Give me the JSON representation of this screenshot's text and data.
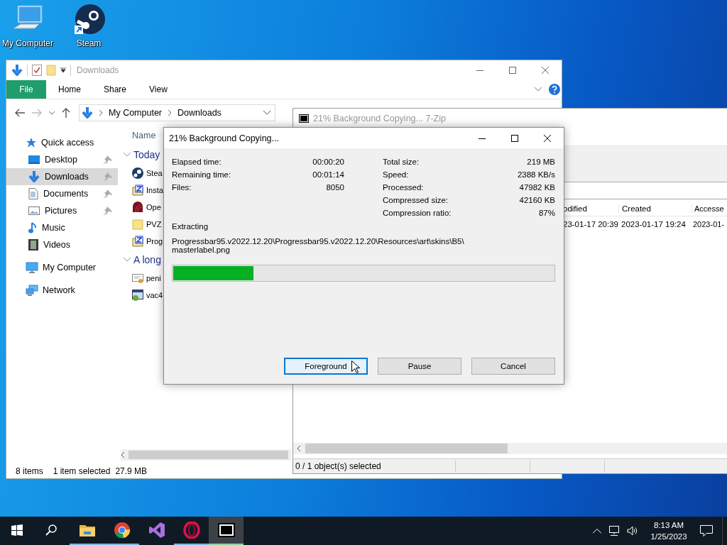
{
  "desktop_icons": [
    {
      "label": "My Computer"
    },
    {
      "label": "Steam"
    }
  ],
  "explorer": {
    "title": "Downloads",
    "ribbon_tabs": [
      {
        "label": "File",
        "kind": "file-menu"
      },
      {
        "label": "Home",
        "kind": "tab"
      },
      {
        "label": "Share",
        "kind": "tab"
      },
      {
        "label": "View",
        "kind": "tab"
      }
    ],
    "address": [
      "My Computer",
      "Downloads"
    ],
    "nav": [
      {
        "label": "Quick access",
        "selected": false,
        "pinned": false,
        "children": [
          {
            "label": "Desktop",
            "selected": false,
            "pinned": true
          },
          {
            "label": "Downloads",
            "selected": true,
            "pinned": true
          },
          {
            "label": "Documents",
            "selected": false,
            "pinned": true
          },
          {
            "label": "Pictures",
            "selected": false,
            "pinned": true
          },
          {
            "label": "Music",
            "selected": false,
            "pinned": false
          },
          {
            "label": "Videos",
            "selected": false,
            "pinned": false
          }
        ]
      },
      {
        "label": "My Computer",
        "selected": false,
        "pinned": false
      },
      {
        "label": "Network",
        "selected": false,
        "pinned": false
      }
    ],
    "name_column": "Name",
    "groups": [
      {
        "label": "Today",
        "items": [
          "Stea",
          "Insta",
          "Ope",
          "PVZ",
          "Prog"
        ]
      },
      {
        "label": "A long",
        "items": [
          "peni",
          "vac4"
        ]
      }
    ],
    "status": {
      "count": "8 items",
      "selection": "1 item selected",
      "size": "27.9 MB"
    }
  },
  "sevenzip": {
    "title": "21% Background Copying... 7-Zip",
    "columns": [
      "odified",
      "Created",
      "Accesse"
    ],
    "rows": [
      [
        "23-01-17 20:39",
        "2023-01-17 19:24",
        "2023-01-"
      ]
    ],
    "status": "0 / 1 object(s) selected"
  },
  "dialog": {
    "title": "21% Background Copying...",
    "left_stats": [
      {
        "label": "Elapsed time:",
        "value": "00:00:20"
      },
      {
        "label": "Remaining time:",
        "value": "00:01:14"
      },
      {
        "label": "Files:",
        "value": "8050"
      }
    ],
    "right_stats": [
      {
        "label": "Total size:",
        "value": "219 MB"
      },
      {
        "label": "Speed:",
        "value": "2388 KB/s"
      },
      {
        "label": "Processed:",
        "value": "47982 KB"
      },
      {
        "label": "Compressed size:",
        "value": "42160 KB"
      },
      {
        "label": "Compression ratio:",
        "value": "87%"
      }
    ],
    "action": "Extracting",
    "path_lines": [
      "Progressbar95.v2022.12.20\\Progressbar95.v2022.12.20\\Resources\\art\\skins\\B5\\",
      "masterlabel.png"
    ],
    "progress": {
      "level": 0.21
    },
    "buttons": [
      {
        "label": "Foreground",
        "focused": true
      },
      {
        "label": "Pause",
        "focused": false
      },
      {
        "label": "Cancel",
        "focused": false
      }
    ]
  },
  "taskbar": {
    "apps": [
      {
        "running": true,
        "selected": false
      },
      {
        "running": true,
        "selected": false
      },
      {
        "running": false,
        "selected": false
      },
      {
        "running": true,
        "selected": false
      },
      {
        "running": true,
        "selected": true
      }
    ],
    "time": "8:13 AM",
    "date": "1/25/2023"
  }
}
